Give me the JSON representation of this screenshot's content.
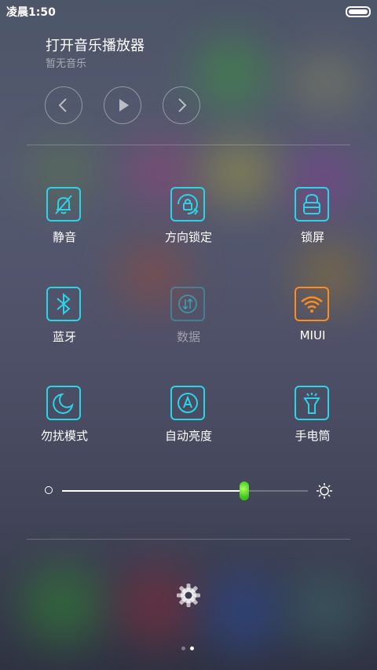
{
  "status": {
    "time": "凌晨1:50"
  },
  "music": {
    "title": "打开音乐播放器",
    "subtitle": "暂无音乐",
    "controls": [
      "chevron-left-icon",
      "play-icon",
      "chevron-right-icon"
    ]
  },
  "toggles": [
    {
      "label": "静音",
      "icon": "mute-bell-icon",
      "state": "on"
    },
    {
      "label": "方向锁定",
      "icon": "rotation-lock-icon",
      "state": "on"
    },
    {
      "label": "锁屏",
      "icon": "lock-icon",
      "state": "on"
    },
    {
      "label": "蓝牙",
      "icon": "bluetooth-icon",
      "state": "on"
    },
    {
      "label": "数据",
      "icon": "data-icon",
      "state": "off"
    },
    {
      "label": "MIUI",
      "icon": "wifi-icon",
      "state": "connected"
    },
    {
      "label": "勿扰模式",
      "icon": "moon-icon",
      "state": "on"
    },
    {
      "label": "自动亮度",
      "icon": "auto-brightness-icon",
      "state": "on"
    },
    {
      "label": "手电筒",
      "icon": "flashlight-icon",
      "state": "on"
    }
  ],
  "brightness": {
    "level": 0.74
  },
  "colors": {
    "accent": "#2ad4e6",
    "wifi": "#ff8a1e",
    "slider_thumb": "#39c418"
  },
  "pager": {
    "pages": 2,
    "current": 2
  }
}
